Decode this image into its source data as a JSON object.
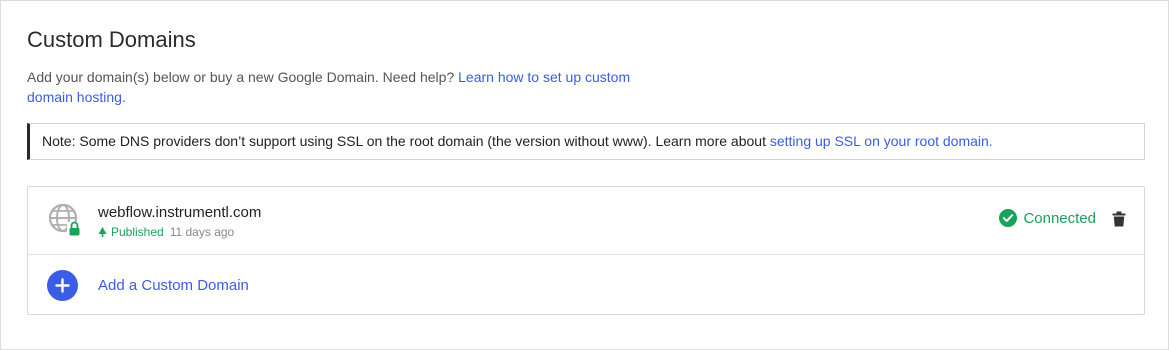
{
  "section": {
    "title": "Custom Domains",
    "description": "Add your domain(s) below or buy a new Google Domain. Need help?",
    "help_link": "Learn how to set up custom domain hosting."
  },
  "note": {
    "text": "Note: Some DNS providers don’t support using SSL on the root domain (the version without www). Learn more about",
    "link": "setting up SSL on your root domain."
  },
  "domains": [
    {
      "name": "webflow.instrumentl.com",
      "published_label": "Published",
      "published_time": "11 days ago",
      "status": "Connected"
    }
  ],
  "add_domain": {
    "label": "Add a Custom Domain"
  },
  "colors": {
    "accent": "#3c5ce6",
    "success": "#18a35b"
  },
  "icons": {
    "globe": "globe-lock-icon",
    "published": "tree-icon",
    "status": "check-circle-icon",
    "delete": "trash-icon",
    "add": "plus-circle-icon"
  }
}
